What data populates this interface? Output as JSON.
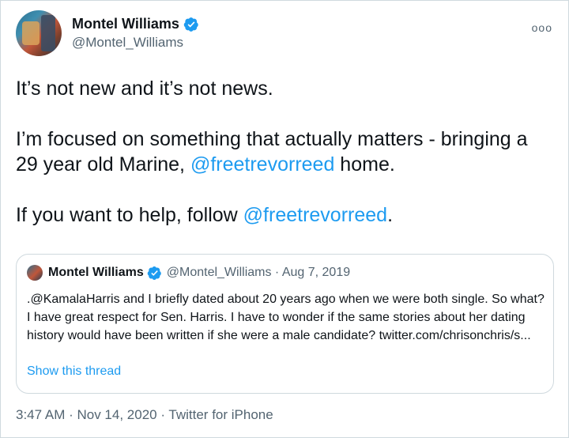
{
  "author": {
    "name": "Montel Williams",
    "handle": "@Montel_Williams"
  },
  "menu_glyph": "ooo",
  "tweet": {
    "line1": "It’s not new and it’s not news.",
    "line2_prefix": "I’m focused on something that actually matters - bringing a 29 year old Marine, ",
    "line2_mention": "@freetrevorreed",
    "line2_suffix": " home.",
    "line3_prefix": "If you want to help, follow ",
    "line3_mention": "@freetrevorreed",
    "line3_suffix": "."
  },
  "quoted": {
    "name": "Montel Williams",
    "meta": "@Montel_Williams · Aug 7, 2019",
    "text": ".@KamalaHarris and I briefly dated about 20 years ago when we were both single. So what? I have great respect for Sen. Harris. I have to wonder if the same stories about her dating history would have been written if she were a male candidate? twitter.com/chrisonchris/s...",
    "thread_link": "Show this thread"
  },
  "footer": "3:47 AM · Nov 14, 2020 · Twitter for iPhone",
  "colors": {
    "accent": "#1d9bf0",
    "text": "#0f1419",
    "secondary": "#536471",
    "border": "#cfd9de"
  },
  "icons": [
    "verified-badge-icon",
    "more-options-icon"
  ]
}
